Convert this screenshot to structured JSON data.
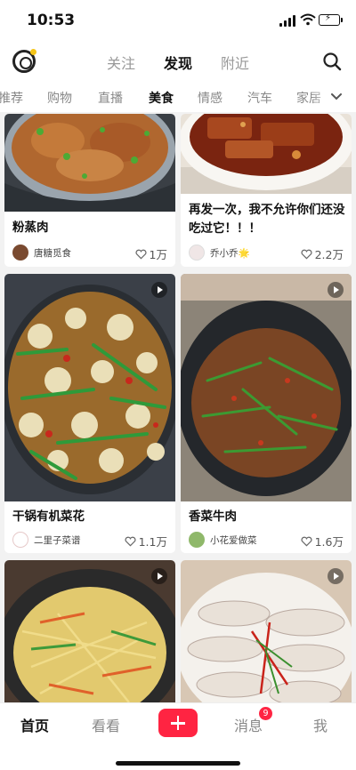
{
  "status_bar": {
    "time": "10:53"
  },
  "header": {
    "tabs": [
      {
        "label": "关注",
        "active": false
      },
      {
        "label": "发现",
        "active": true
      },
      {
        "label": "附近",
        "active": false
      }
    ],
    "search_icon": "search-icon"
  },
  "categories": {
    "items": [
      "推荐",
      "购物",
      "直播",
      "美食",
      "情感",
      "汽车",
      "家居"
    ],
    "active": "美食",
    "expand_icon": "chevron-down-icon"
  },
  "feed": {
    "cards": [
      {
        "title": "粉蒸肉",
        "author": "唐糖觅食",
        "likes": "1万",
        "video": false
      },
      {
        "title": "再发一次，我不允许你们还没吃过它！！！",
        "author": "乔小乔🌟",
        "likes": "2.2万",
        "video": false
      },
      {
        "title": "干锅有机菜花",
        "author": "二里子菜谱",
        "likes": "1.1万",
        "video": true
      },
      {
        "title": "香菜牛肉",
        "author": "小花爱做菜",
        "likes": "1.6万",
        "video": true
      },
      {
        "title": "",
        "author": "",
        "likes": "",
        "video": true
      },
      {
        "title": "",
        "author": "",
        "likes": "",
        "video": true
      }
    ]
  },
  "bottom_nav": {
    "home": "首页",
    "watch": "看看",
    "post_icon": "plus-icon",
    "messages": "消息",
    "messages_badge": "9",
    "me": "我"
  },
  "colors": {
    "accent": "#ff2442",
    "active_text": "#111111",
    "inactive_text": "#999999"
  }
}
